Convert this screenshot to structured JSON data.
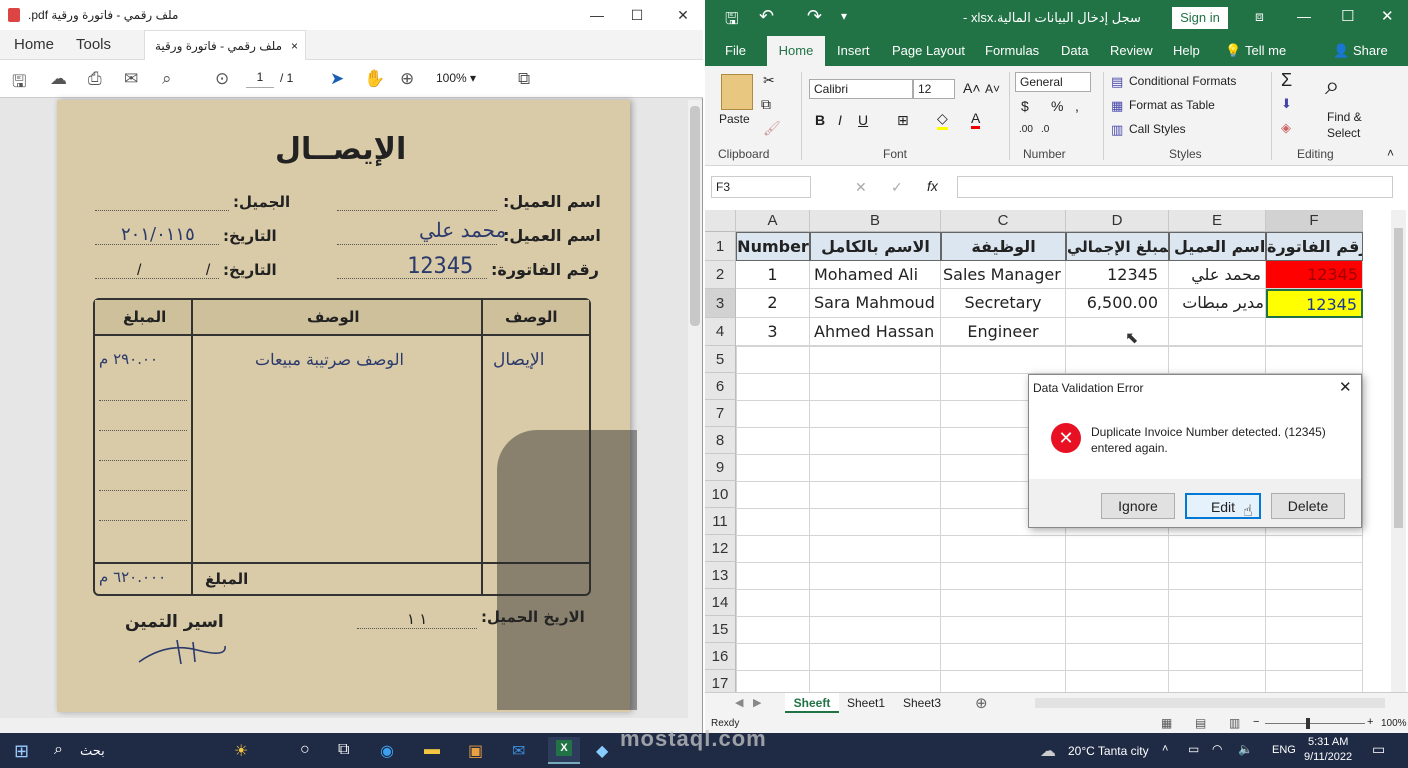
{
  "pdf": {
    "title": "ملف رقمي - فاتورة ورقية pdf.",
    "tabs": {
      "home": "Home",
      "tools": "Tools",
      "doc": "ملف رقمي - فاتورة ورقية"
    },
    "page_current": "1",
    "page_total": "/ 1",
    "zoom": "100%",
    "receipt": {
      "heading": "الإيصــال",
      "lbl_customer1": "اسم العميل:",
      "lbl_total_top": "الجميل:",
      "lbl_customer2": "اسم العميل:",
      "customer_value": "محمد علي",
      "lbl_date1": "التاريخ:",
      "date1_value": "٢٠١/٠١١٥",
      "lbl_invoice": "رقم الفاتورة:",
      "invoice_value": "12345",
      "lbl_date2": "التاريخ:",
      "date2_value": "/ /",
      "col1": "الوصف",
      "col2": "الوصف",
      "col3": "المبلغ",
      "row1_c1": "الإيصال",
      "row1_c2": "الوصف صرتيبة مبيعات",
      "row1_c3": "٢٩٠.٠٠ م",
      "footer_label": "المبلغ",
      "footer_amount": "٦٢٠.٠٠٠ م",
      "lbl_delivery": "الاريخ الحميل:",
      "delivery_value": "١ ١",
      "signature_label": "اسير التمين"
    }
  },
  "excel": {
    "qat_title": "سجل إدخال البيانات المالية.xlsx -",
    "signin": "Sign in",
    "menu": [
      "File",
      "Home",
      "Insert",
      "Page Layout",
      "Formulas",
      "Data",
      "Review",
      "Help",
      "Tell me",
      "Share"
    ],
    "ribbon": {
      "paste": "Paste",
      "clipboard": "Clipboard",
      "font_name": "Calibri",
      "font_size": "12",
      "font": "Font",
      "number_format": "General",
      "number": "Number",
      "cond_format": "Conditional Formats",
      "format_table": "Format as Table",
      "cell_styles": "Call Styles",
      "styles": "Styles",
      "find_select_1": "Find &",
      "find_select_2": "Select",
      "editing": "Editing"
    },
    "name_box": "F3",
    "columns": [
      "A",
      "B",
      "C",
      "D",
      "E",
      "F"
    ],
    "rows": [
      "1",
      "2",
      "3",
      "4",
      "5",
      "6",
      "7",
      "8",
      "9",
      "10",
      "11",
      "12",
      "13",
      "14",
      "15",
      "16",
      "17"
    ],
    "header": [
      "Number",
      "الاسم بالكامل",
      "الوظيفة",
      "المبلغ الإجمالي",
      "اسم العميل",
      "رقم الفاتورة"
    ],
    "data": [
      [
        "1",
        "Mohamed Ali",
        "Sales Manager",
        "12345",
        "محمد علي",
        "12345"
      ],
      [
        "2",
        "Sara Mahmoud",
        "Secretary",
        "6,500.00",
        "مدير مبطات",
        "12345"
      ],
      [
        "3",
        "Ahmed Hassan",
        "Engineer",
        "",
        "",
        ""
      ]
    ],
    "dialog": {
      "title": "Data Validation Error",
      "message_1": "Duplicate Invoice Number detected. (12345)",
      "message_2": "entered again.",
      "ignore": "Ignore",
      "edit": "Edit",
      "delete": "Delete"
    },
    "sheets": [
      "Sheeft",
      "Sheet1",
      "Sheet3"
    ],
    "status": "Rexdy",
    "zoom": "100%",
    "colors": {
      "brand": "#217346",
      "dup_red": "#ff0000",
      "dup_yellow": "#ffff00"
    }
  },
  "taskbar": {
    "search": "بحث",
    "weather": "20°C  Tanta city",
    "lang": "ENG",
    "time": "5:31 AM",
    "date": "9/11/2022"
  },
  "watermark": "mostaql.com"
}
